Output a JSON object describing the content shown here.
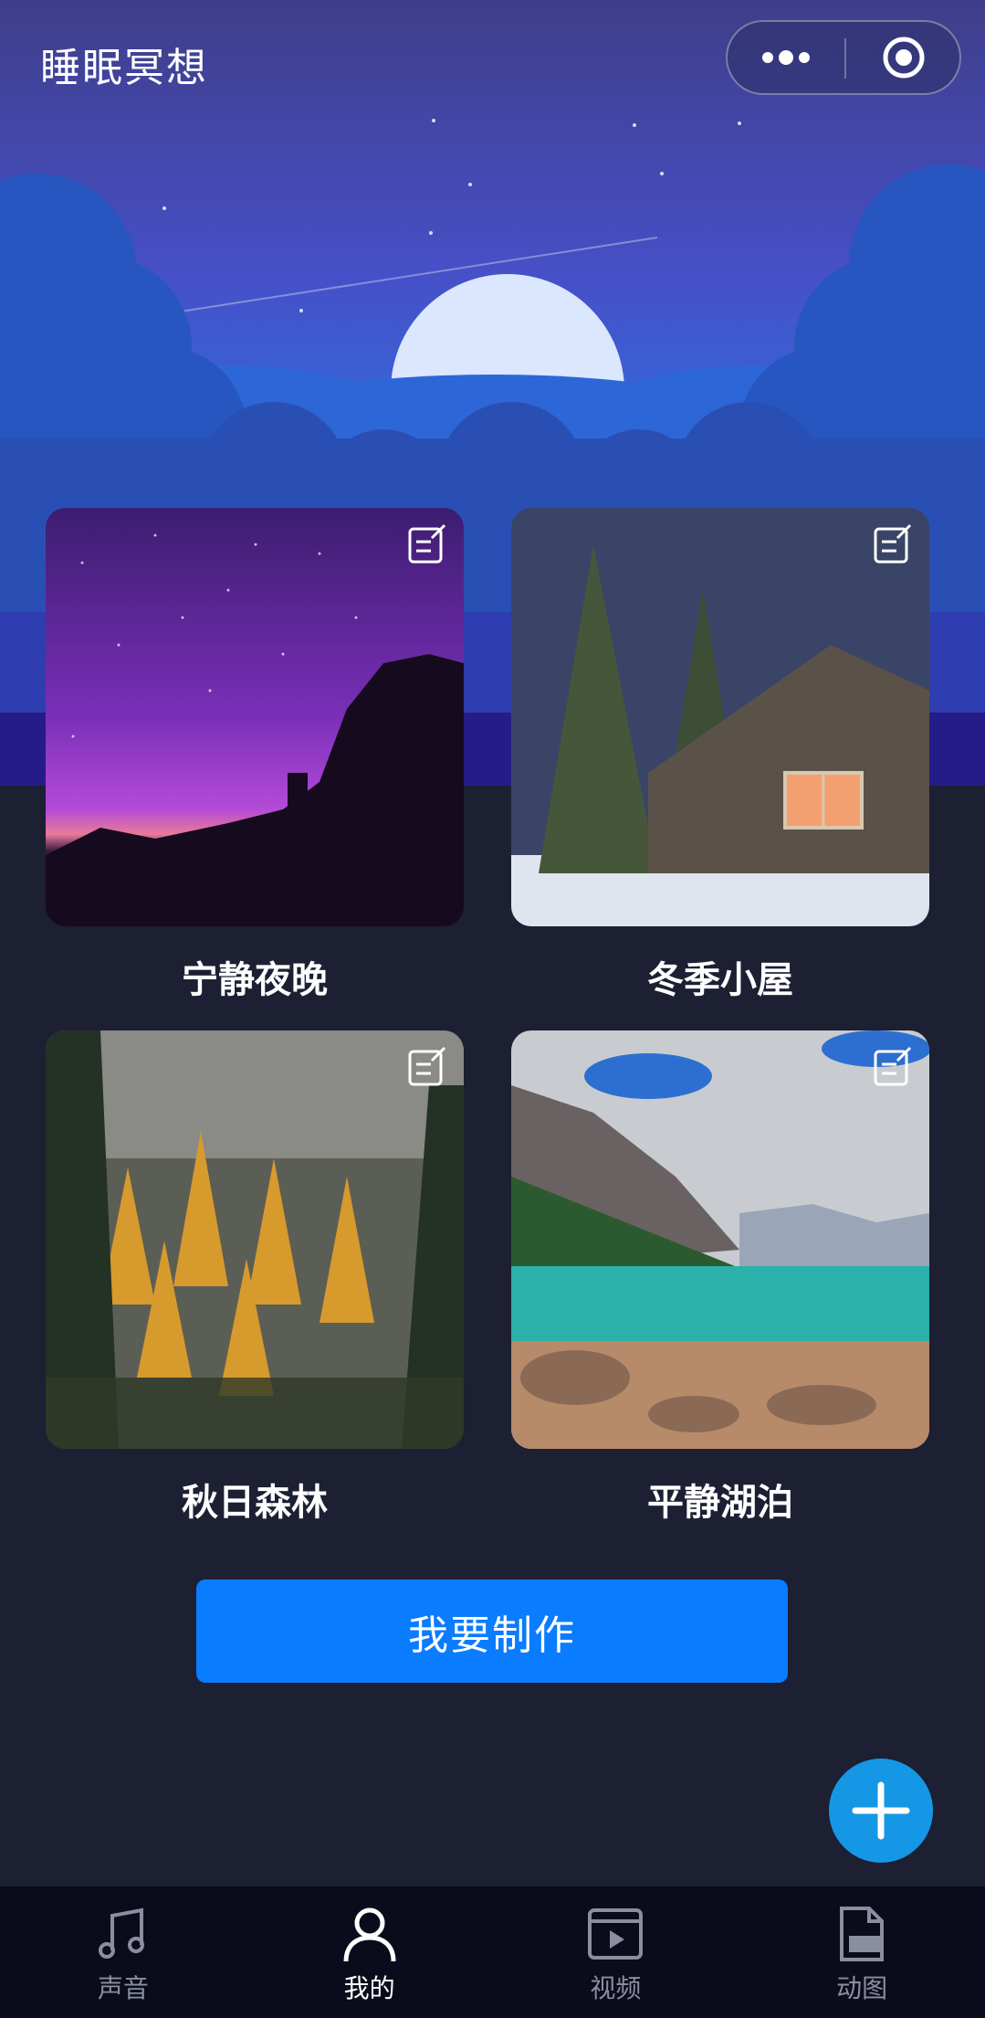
{
  "header": {
    "title": "睡眠冥想"
  },
  "scenes": [
    {
      "label": "宁静夜晚"
    },
    {
      "label": "冬季小屋"
    },
    {
      "label": "秋日森林"
    },
    {
      "label": "平静湖泊"
    }
  ],
  "make_button": {
    "label": "我要制作"
  },
  "tabbar": {
    "items": [
      {
        "label": "声音",
        "icon": "music-note-icon",
        "active": false
      },
      {
        "label": "我的",
        "icon": "user-icon",
        "active": true
      },
      {
        "label": "视频",
        "icon": "video-icon",
        "active": false
      },
      {
        "label": "动图",
        "icon": "gif-icon",
        "active": false
      }
    ]
  },
  "colors": {
    "background": "#1d1f33",
    "accent": "#0a7cff",
    "fab": "#1597e5",
    "tabbar": "#0a0c1c"
  }
}
